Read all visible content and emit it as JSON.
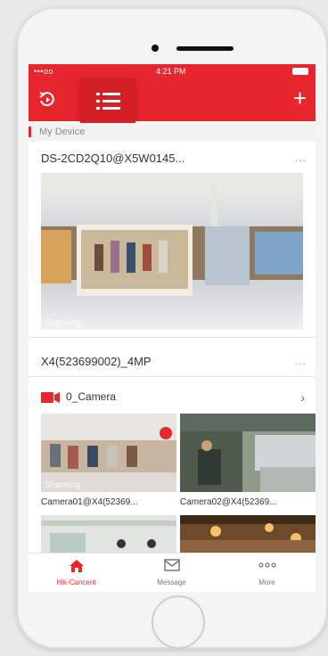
{
  "status_bar": {
    "carrier": "•••oo",
    "time": "4:21 PM"
  },
  "header": {
    "replay_icon": "replay-icon",
    "menu_icon": "list-icon",
    "add_icon": "plus-icon"
  },
  "section": {
    "label": "My Device"
  },
  "devices": [
    {
      "name": "DS-2CD2Q10@X5W0145...",
      "more": "...",
      "thumb_label": "Shareing"
    },
    {
      "name": "X4(523699002)_4MP",
      "more": "..."
    }
  ],
  "camera_group": {
    "label": "0_Camera",
    "icon": "camera-icon",
    "chevron": "›"
  },
  "cameras": [
    {
      "label": "Camera01@X4(52369...",
      "thumb_label": "Shareing"
    },
    {
      "label": "Camera02@X4(52369..."
    }
  ],
  "tabs": [
    {
      "label": "Hik-Concent",
      "icon": "home-icon",
      "active": true
    },
    {
      "label": "Message",
      "icon": "mail-icon",
      "active": false
    },
    {
      "label": "More",
      "icon": "more-icon",
      "active": false
    }
  ],
  "colors": {
    "accent": "#e8262d",
    "text": "#333333",
    "muted": "#8a8a8a"
  }
}
